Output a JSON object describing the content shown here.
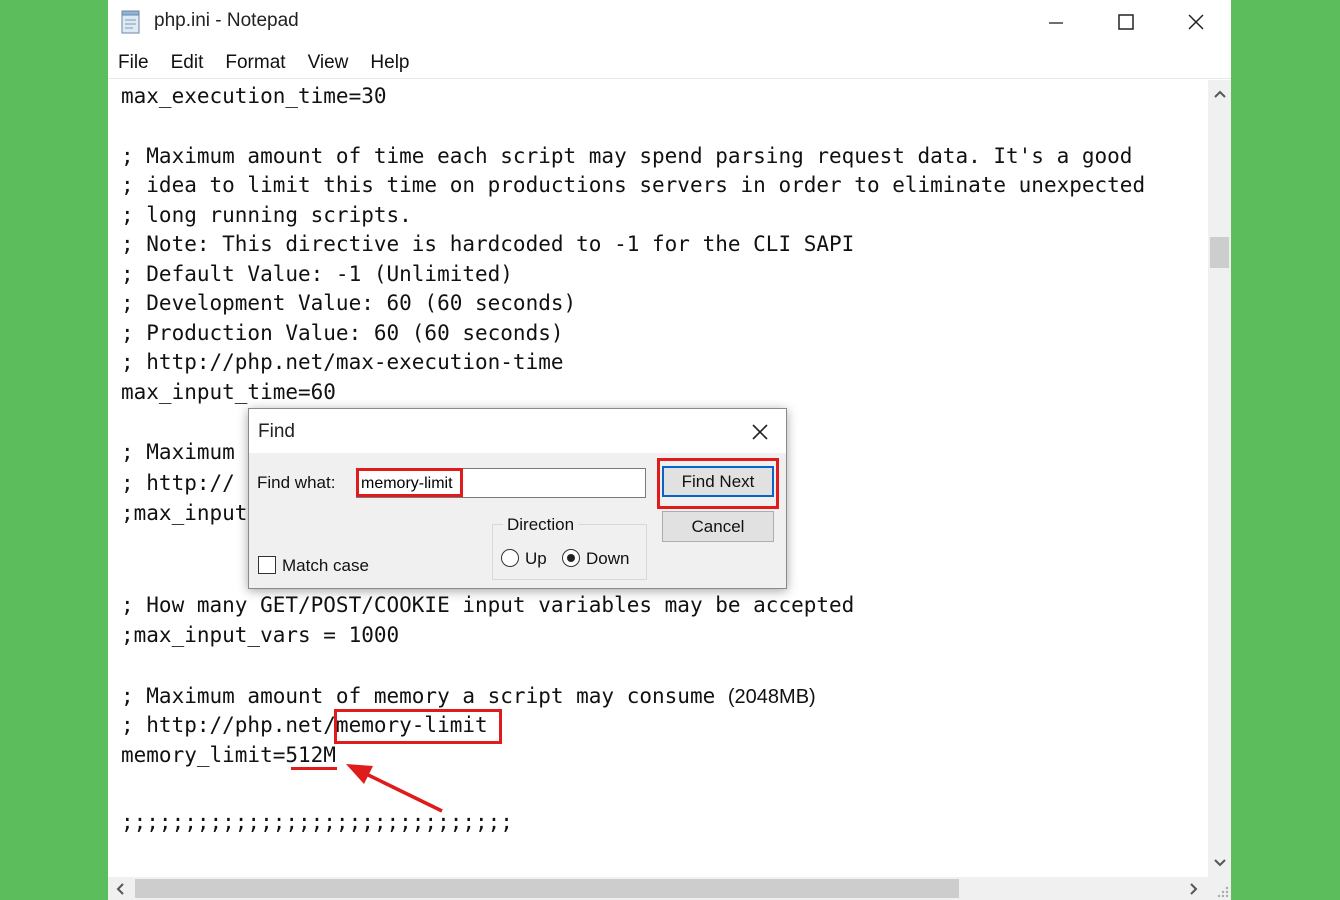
{
  "window": {
    "title": "php.ini - Notepad",
    "icon": "notepad-icon"
  },
  "menu": [
    "File",
    "Edit",
    "Format",
    "View",
    "Help"
  ],
  "editor_lines": [
    "max_execution_time=30",
    "",
    "; Maximum amount of time each script may spend parsing request data. It's a good",
    "; idea to limit this time on productions servers in order to eliminate unexpected",
    "; long running scripts.",
    "; Note: This directive is hardcoded to -1 for the CLI SAPI",
    "; Default Value: -1 (Unlimited)",
    "; Development Value: 60 (60 seconds)",
    "; Production Value: 60 (60 seconds)",
    "; http://php.net/max-execution-time",
    "max_input_time=60",
    "",
    "; Maximum",
    "; http://",
    ";max_input",
    "",
    "",
    "; How many GET/POST/COOKIE input variables may be accepted",
    ";max_input_vars = 1000",
    "",
    "; Maximum amount of memory a script may consume",
    "; http://php.net/memory-limit",
    "memory_limit=512M",
    "",
    "",
    ";;;;;;;;;;;;;;;;;;;;;;;;;;;;;;;"
  ],
  "memory_comment_suffix": "(2048MB)",
  "find_dialog": {
    "title": "Find",
    "find_what_label": "Find what:",
    "find_what_value": "memory-limit",
    "find_next_label": "Find Next",
    "cancel_label": "Cancel",
    "direction_label": "Direction",
    "up_label": "Up",
    "down_label": "Down",
    "direction_selected": "Down",
    "match_case_label": "Match case",
    "match_case_checked": false
  },
  "colors": {
    "background": "#5cbd5c",
    "highlight": "#e01b1b",
    "default_button_border": "#0a64c8"
  }
}
